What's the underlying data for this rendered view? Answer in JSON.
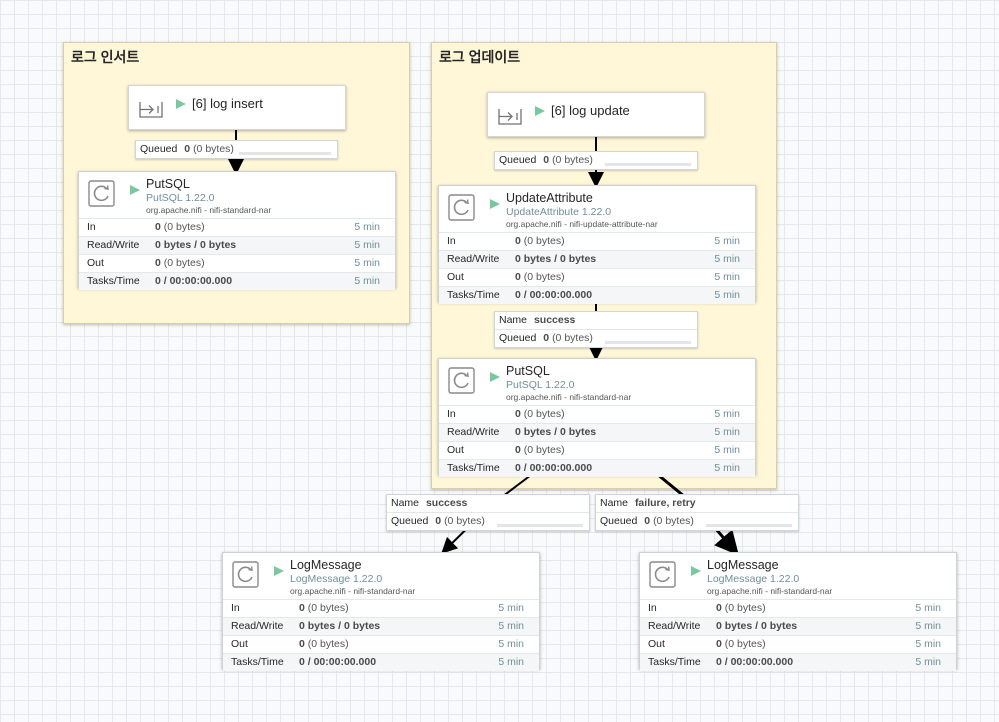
{
  "canvas": {
    "groups": [
      {
        "title": "로그 인서트"
      },
      {
        "title": "로그 업데이트"
      }
    ],
    "ports": [
      {
        "name": "[6] log insert",
        "icon": "input-port-icon",
        "status": "play-icon"
      },
      {
        "name": "[6] log update",
        "icon": "input-port-icon",
        "status": "play-icon"
      }
    ],
    "connections": [
      {
        "name_label": "",
        "name_value": "",
        "queued_label": "Queued",
        "queued_count": "0",
        "queued_size": "(0 bytes)"
      },
      {
        "name_label": "",
        "name_value": "",
        "queued_label": "Queued",
        "queued_count": "0",
        "queued_size": "(0 bytes)"
      },
      {
        "name_label": "Name",
        "name_value": "success",
        "queued_label": "Queued",
        "queued_count": "0",
        "queued_size": "(0 bytes)"
      },
      {
        "name_label": "Name",
        "name_value": "success",
        "queued_label": "Queued",
        "queued_count": "0",
        "queued_size": "(0 bytes)"
      },
      {
        "name_label": "Name",
        "name_value": "failure, retry",
        "queued_label": "Queued",
        "queued_count": "0",
        "queued_size": "(0 bytes)"
      }
    ],
    "processors": [
      {
        "name": "PutSQL",
        "type": "PutSQL 1.22.0",
        "bundle": "org.apache.nifi - nifi-standard-nar",
        "stats": [
          {
            "label": "In",
            "count": "0",
            "size": "(0 bytes)",
            "window": "5 min"
          },
          {
            "label": "Read/Write",
            "count": "0 bytes / 0 bytes",
            "size": "",
            "window": "5 min"
          },
          {
            "label": "Out",
            "count": "0",
            "size": "(0 bytes)",
            "window": "5 min"
          },
          {
            "label": "Tasks/Time",
            "count": "0 / 00:00:00.000",
            "size": "",
            "window": "5 min"
          }
        ]
      },
      {
        "name": "UpdateAttribute",
        "type": "UpdateAttribute 1.22.0",
        "bundle": "org.apache.nifi - nifi-update-attribute-nar",
        "stats": [
          {
            "label": "In",
            "count": "0",
            "size": "(0 bytes)",
            "window": "5 min"
          },
          {
            "label": "Read/Write",
            "count": "0 bytes / 0 bytes",
            "size": "",
            "window": "5 min"
          },
          {
            "label": "Out",
            "count": "0",
            "size": "(0 bytes)",
            "window": "5 min"
          },
          {
            "label": "Tasks/Time",
            "count": "0 / 00:00:00.000",
            "size": "",
            "window": "5 min"
          }
        ]
      },
      {
        "name": "PutSQL",
        "type": "PutSQL 1.22.0",
        "bundle": "org.apache.nifi - nifi-standard-nar",
        "stats": [
          {
            "label": "In",
            "count": "0",
            "size": "(0 bytes)",
            "window": "5 min"
          },
          {
            "label": "Read/Write",
            "count": "0 bytes / 0 bytes",
            "size": "",
            "window": "5 min"
          },
          {
            "label": "Out",
            "count": "0",
            "size": "(0 bytes)",
            "window": "5 min"
          },
          {
            "label": "Tasks/Time",
            "count": "0 / 00:00:00.000",
            "size": "",
            "window": "5 min"
          }
        ]
      },
      {
        "name": "LogMessage",
        "type": "LogMessage 1.22.0",
        "bundle": "org.apache.nifi - nifi-standard-nar",
        "stats": [
          {
            "label": "In",
            "count": "0",
            "size": "(0 bytes)",
            "window": "5 min"
          },
          {
            "label": "Read/Write",
            "count": "0 bytes / 0 bytes",
            "size": "",
            "window": "5 min"
          },
          {
            "label": "Out",
            "count": "0",
            "size": "(0 bytes)",
            "window": "5 min"
          },
          {
            "label": "Tasks/Time",
            "count": "0 / 00:00:00.000",
            "size": "",
            "window": "5 min"
          }
        ]
      },
      {
        "name": "LogMessage",
        "type": "LogMessage 1.22.0",
        "bundle": "org.apache.nifi - nifi-standard-nar",
        "stats": [
          {
            "label": "In",
            "count": "0",
            "size": "(0 bytes)",
            "window": "5 min"
          },
          {
            "label": "Read/Write",
            "count": "0 bytes / 0 bytes",
            "size": "",
            "window": "5 min"
          },
          {
            "label": "Out",
            "count": "0",
            "size": "(0 bytes)",
            "window": "5 min"
          },
          {
            "label": "Tasks/Time",
            "count": "0 / 00:00:00.000",
            "size": "",
            "window": "5 min"
          }
        ]
      }
    ],
    "colors": {
      "group_bg": "#fff7d7",
      "run_green": "#7dc7a0",
      "stat_time": "#728e9b"
    }
  }
}
